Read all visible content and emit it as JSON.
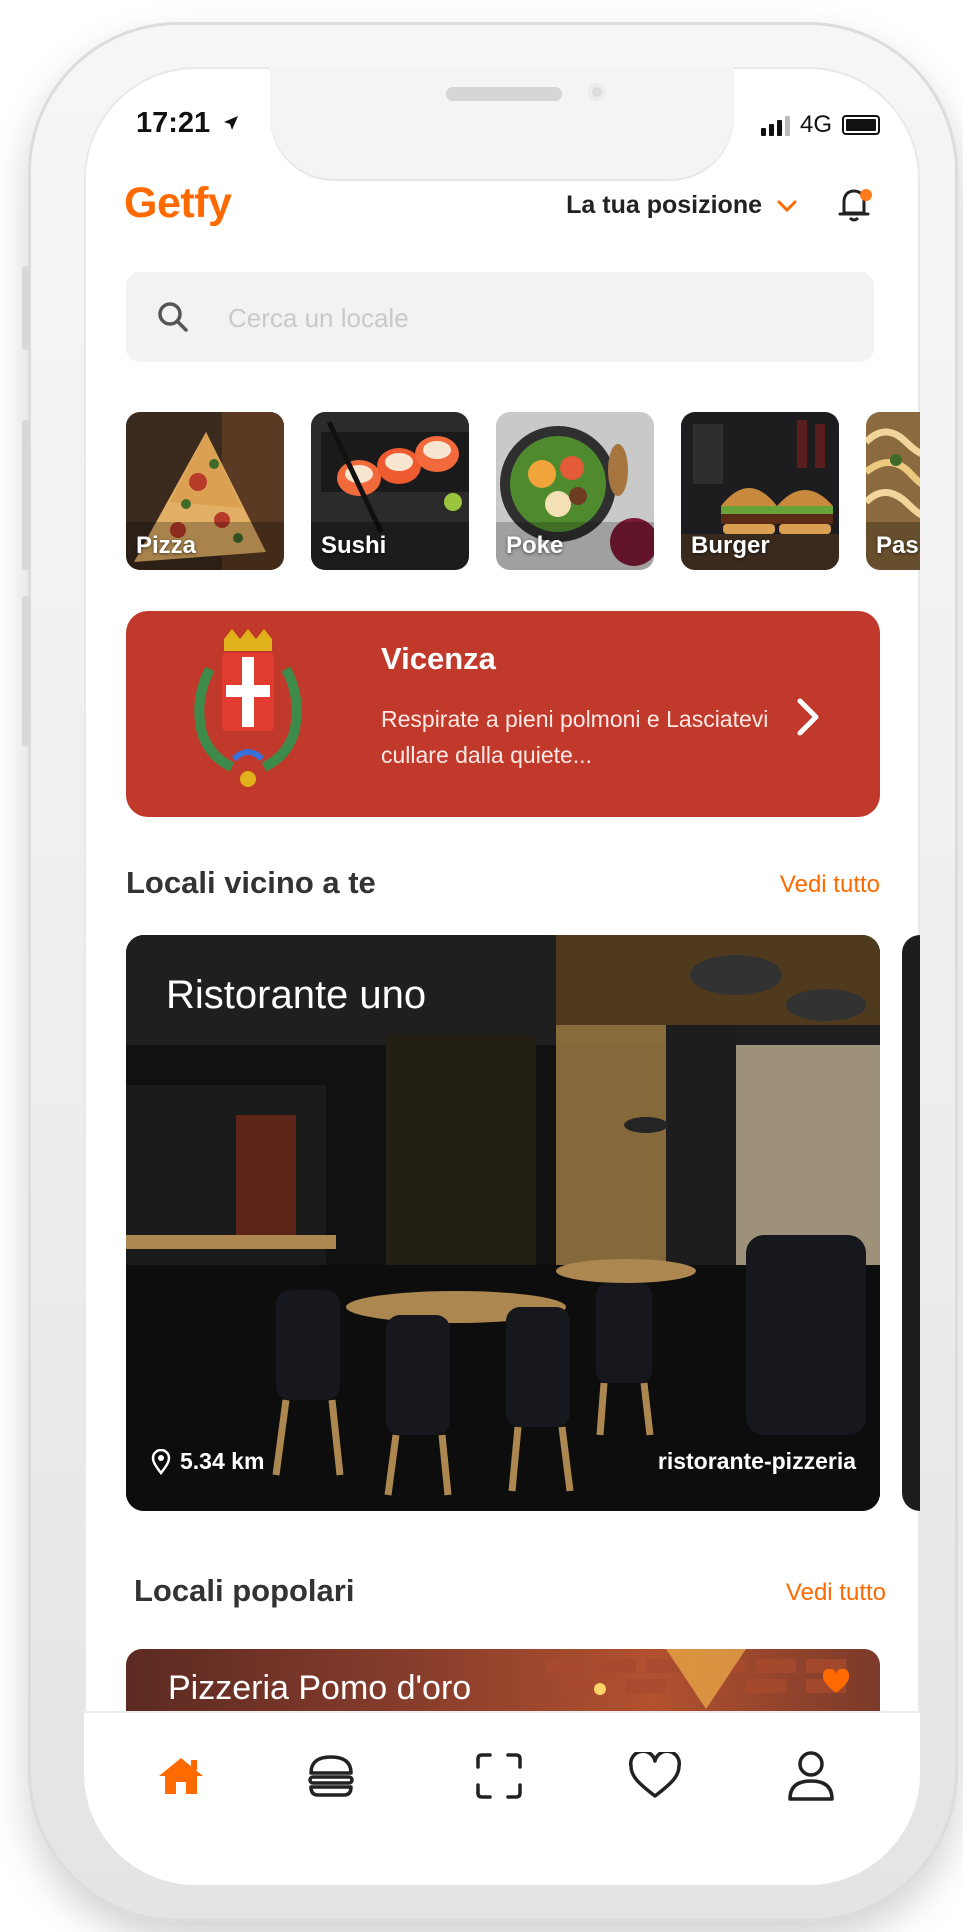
{
  "status": {
    "time": "17:21",
    "network": "4G"
  },
  "header": {
    "logo": "Getfy",
    "location_label": "La tua posizione"
  },
  "search": {
    "placeholder": "Cerca un locale"
  },
  "categories": [
    {
      "label": "Pizza"
    },
    {
      "label": "Sushi"
    },
    {
      "label": "Poke"
    },
    {
      "label": "Burger"
    },
    {
      "label": "Pas"
    }
  ],
  "banner": {
    "title": "Vicenza",
    "description": "Respirate a pieni polmoni e Lasciatevi cullare dalla quiete..."
  },
  "nearby": {
    "title": "Locali vicino a te",
    "see_all": "Vedi tutto",
    "card": {
      "name": "Ristorante uno",
      "distance": "5.34 km",
      "type": "ristorante-pizzeria"
    }
  },
  "popular": {
    "title": "Locali popolari",
    "see_all": "Vedi tutto",
    "card": {
      "name": "Pizzeria Pomo d'oro"
    }
  },
  "tabbar": {
    "active": "home",
    "items": [
      "home-icon",
      "menu-icon",
      "scan-icon",
      "heart-icon",
      "profile-icon"
    ]
  },
  "colors": {
    "accent": "#ff6a00",
    "banner": "#c0392b"
  }
}
